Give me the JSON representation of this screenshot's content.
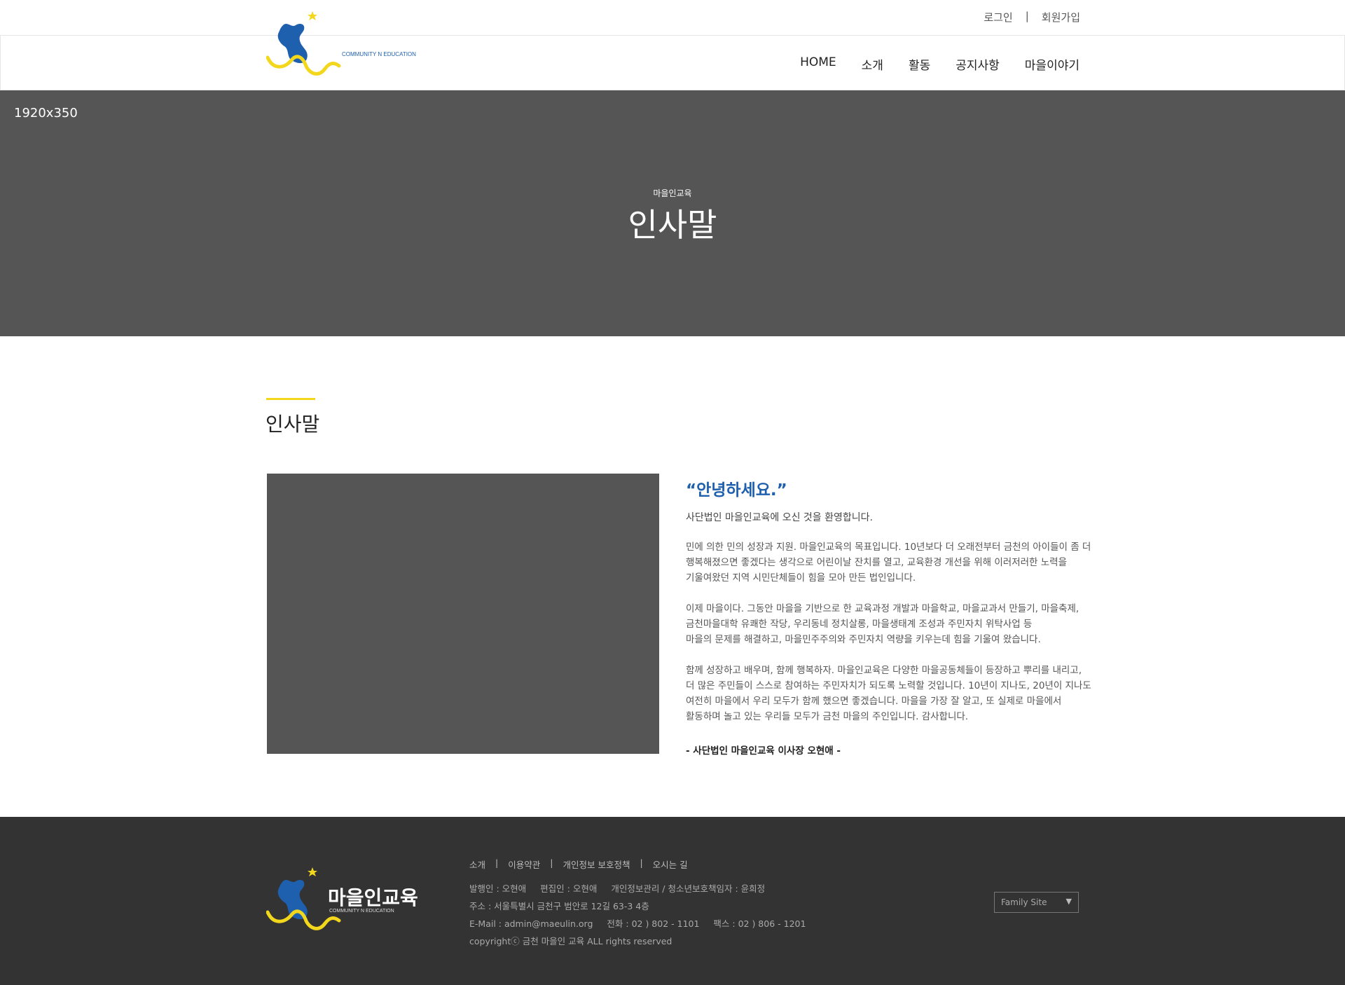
{
  "util": {
    "login": "로그인",
    "separator": "|",
    "signup": "회원가입"
  },
  "logo": {
    "tagline": "COMMUNITY N EDUCATION"
  },
  "nav": [
    "HOME",
    "소개",
    "활동",
    "공지사항",
    "마을이야기"
  ],
  "hero": {
    "placeholder": "1920x350",
    "subtitle": "마을인교육",
    "title": "인사말"
  },
  "section": {
    "title": "인사말"
  },
  "greeting": {
    "hello": "“안녕하세요.”",
    "welcome": "사단법인 마을인교육에 오신 것을 환영합니다.",
    "p1": [
      "민에 의한 민의 성장과 지원. 마을인교육의 목표입니다. 10년보다 더 오래전부터 금천의 아이들이 좀 더",
      "행복해졌으면 좋겠다는 생각으로 어린이날 잔치를 열고, 교육환경 개선을 위해 이러저러한 노력을",
      "기울여왔던 지역 시민단체들이 힘을 모아 만든 법인입니다."
    ],
    "p2": [
      "이제 마을이다. 그동안 마을을 기반으로 한 교육과정 개발과 마을학교, 마을교과서 만들기, 마을축제,",
      "금천마을대학 유쾌한 작당, 우리동네 정치살롱, 마을생태계 조성과 주민자치 위탁사업 등",
      "마을의 문제를 해결하고, 마을민주주의와 주민자치 역량을 키우는데 힘을 기울여 왔습니다."
    ],
    "p3": [
      "함께 성장하고 배우며, 함께 행복하자. 마을인교육은 다양한 마을공동체들이 등장하고 뿌리를 내리고,",
      "더 많은 주민들이 스스로 참여하는 주민자치가 되도록 노력할 것입니다. 10년이 지나도, 20년이 지나도",
      "여전히 마을에서 우리 모두가 함께 했으면 좋겠습니다. 마을을 가장 잘 알고, 또 실제로 마을에서",
      "활동하며 놀고 있는 우리들 모두가 금천 마을의 주인입니다. 감사합니다."
    ],
    "signature": "- 사단법인 마을인교육 이사장 오현애 -"
  },
  "footer": {
    "logo_text": "마을인교육",
    "logo_tagline": "COMMUNITY N EDUCATION",
    "links": [
      "소개",
      "이용약관",
      "개인정보 보호정책",
      "오시는 길"
    ],
    "link_separator": "|",
    "publisher": "발행인 : 오현애",
    "editor": "편집인 : 오현애",
    "privacy_officer": "개인정보관리 / 청소년보호책임자 : 윤희정",
    "address": "주소 : 서울특별시 금천구 범안로 12길 63-3 4층",
    "email": "E-Mail : admin@maeulin.org",
    "phone": "전화 : 02 ) 802 - 1101",
    "fax": "팩스 : 02 ) 806 - 1201",
    "copyright": "copyrightⓒ 금천 마을인 교육 ALL rights reserved",
    "family_site": "Family Site"
  },
  "colors": {
    "accent_yellow": "#f3d71c",
    "accent_blue": "#1e5fae",
    "hero_bg": "#555555",
    "footer_bg": "#333333"
  }
}
